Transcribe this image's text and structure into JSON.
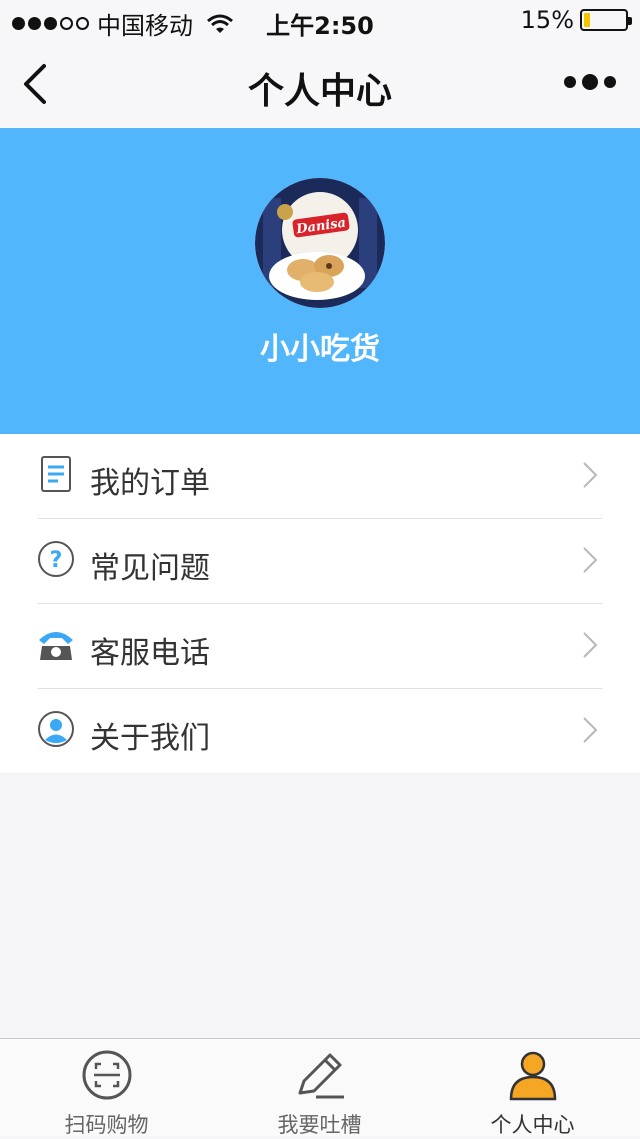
{
  "status_bar": {
    "carrier": "中国移动",
    "time": "上午2:50",
    "battery": "15%",
    "battery_level": 0.15
  },
  "nav": {
    "title": "个人中心",
    "back_icon": "chevron-left-icon",
    "more_icon": "more-dots-icon"
  },
  "profile": {
    "username": "小小吃货",
    "avatar_text": "Danisa",
    "banner_color": "#51b6fb"
  },
  "menu": {
    "items": [
      {
        "label": "我的订单",
        "icon": "order-list-icon"
      },
      {
        "label": "常见问题",
        "icon": "question-icon"
      },
      {
        "label": "客服电话",
        "icon": "telephone-icon"
      },
      {
        "label": "关于我们",
        "icon": "person-circle-icon"
      }
    ]
  },
  "tabbar": {
    "tabs": [
      {
        "label": "扫码购物",
        "icon": "scan-icon",
        "active": false
      },
      {
        "label": "我要吐槽",
        "icon": "edit-pencil-icon",
        "active": false
      },
      {
        "label": "个人中心",
        "icon": "user-icon",
        "active": true
      }
    ],
    "active_color": "#f5a623"
  }
}
